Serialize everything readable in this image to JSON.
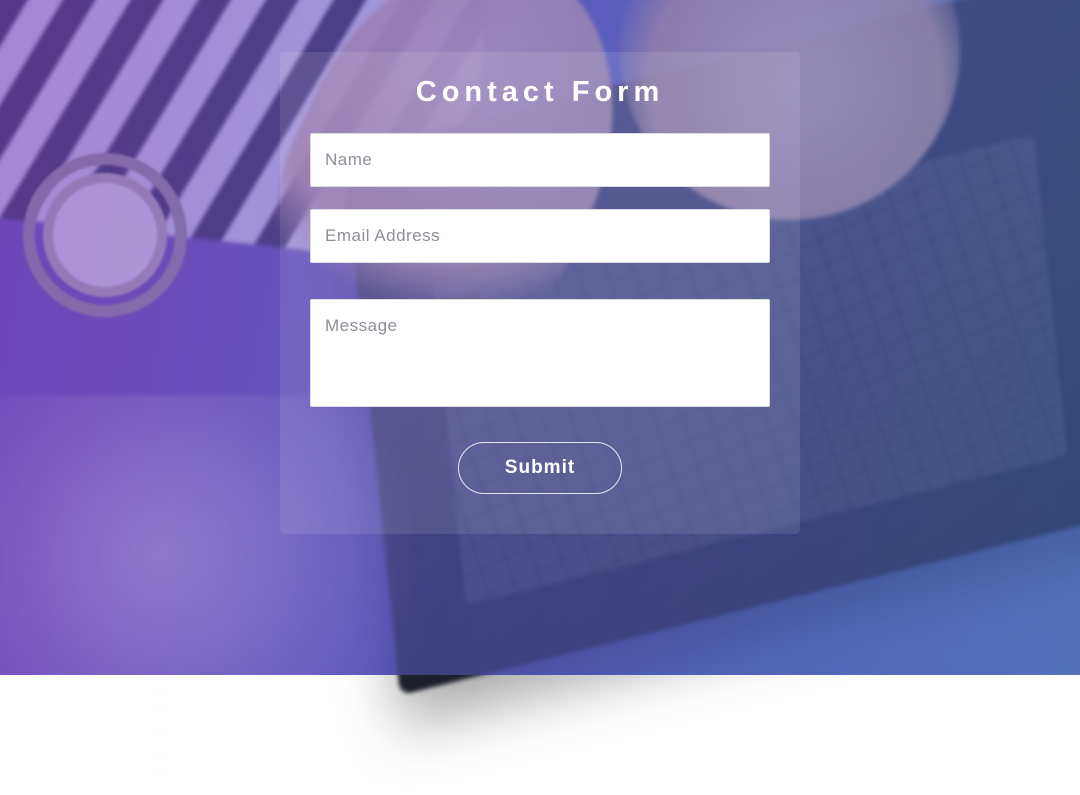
{
  "form": {
    "title": "Contact Form",
    "fields": {
      "name": {
        "placeholder": "Name",
        "value": ""
      },
      "email": {
        "placeholder": "Email Address",
        "value": ""
      },
      "message": {
        "placeholder": "Message",
        "value": ""
      }
    },
    "submit_label": "Submit"
  },
  "colors": {
    "overlay_start": "#7644c4",
    "overlay_end": "#5276d0",
    "card_bg": "rgba(255,255,255,0.10)",
    "input_bg": "#ffffff",
    "placeholder": "#8d8f98",
    "text_on_overlay": "#ffffff"
  }
}
